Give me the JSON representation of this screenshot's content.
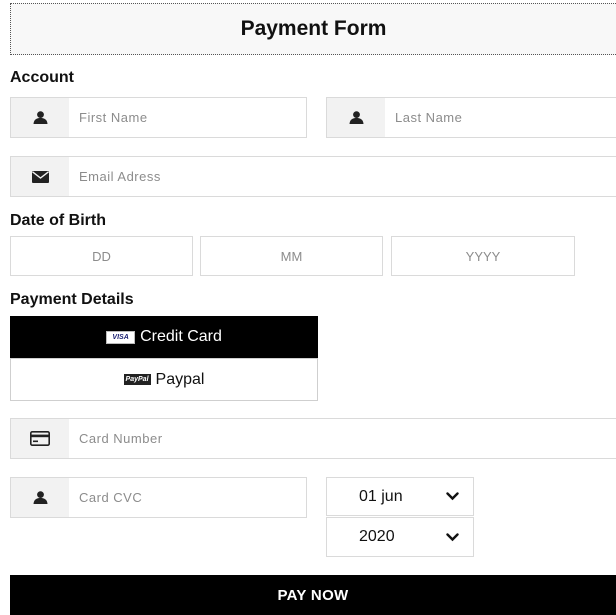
{
  "form": {
    "title": "Payment Form"
  },
  "account": {
    "heading": "Account",
    "first_name_placeholder": "First Name",
    "last_name_placeholder": "Last Name",
    "email_placeholder": "Email Adress"
  },
  "dob": {
    "heading": "Date of Birth",
    "day_placeholder": "DD",
    "month_placeholder": "MM",
    "year_placeholder": "YYYY"
  },
  "payment": {
    "heading": "Payment Details",
    "options": [
      {
        "label": "Credit Card",
        "badge": "VISA",
        "selected": true
      },
      {
        "label": "Paypal",
        "badge": "PayPal",
        "selected": false
      }
    ],
    "card_number_placeholder": "Card Number",
    "card_cvc_placeholder": "Card CVC",
    "expiry_month": "01 jun",
    "expiry_year": "2020"
  },
  "actions": {
    "pay_label": "PAY NOW"
  },
  "icons": {
    "user": "user-icon",
    "email": "envelope-icon",
    "card": "credit-card-icon",
    "chevron": "chevron-down-icon"
  },
  "colors": {
    "accent": "#000000",
    "icon_bg": "#f2f2f2",
    "border": "#dadada",
    "placeholder": "#8c8c8c"
  }
}
